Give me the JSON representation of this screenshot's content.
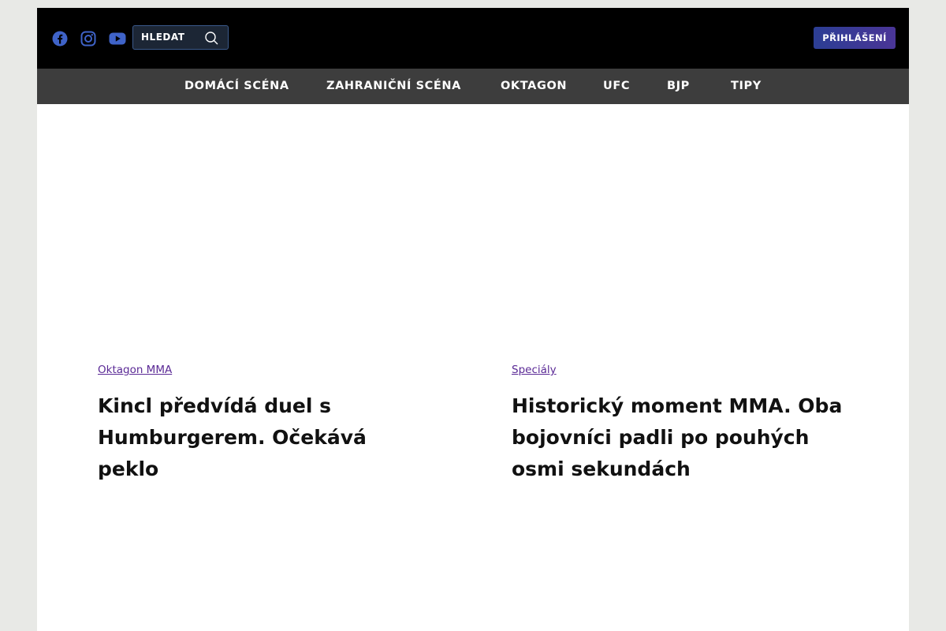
{
  "header": {
    "social": [
      {
        "icon": "facebook-icon",
        "color": "#3f63c8"
      },
      {
        "icon": "instagram-icon",
        "color": "#3f63c8"
      },
      {
        "icon": "youtube-icon",
        "color": "#3f63c8"
      }
    ],
    "search_label": "HLEDAT",
    "login_label": "PŘIHLÁŠENÍ"
  },
  "nav": {
    "items": [
      "DOMÁCÍ SCÉNA",
      "ZAHRANIČNÍ SCÉNA",
      "OKTAGON",
      "UFC",
      "BJP",
      "TIPY"
    ]
  },
  "articles": [
    {
      "category": "Oktagon MMA",
      "title": "Kincl předvídá duel s Humburgerem. Očekává peklo"
    },
    {
      "category": "Speciály",
      "title": "Historický moment MMA. Oba bojovníci padli po pouhých osmi sekundách"
    }
  ],
  "colors": {
    "accent": "#5b2a96",
    "topbar": "#000000",
    "navbar": "#3d3d3d",
    "login_button": "#3a3a96"
  }
}
